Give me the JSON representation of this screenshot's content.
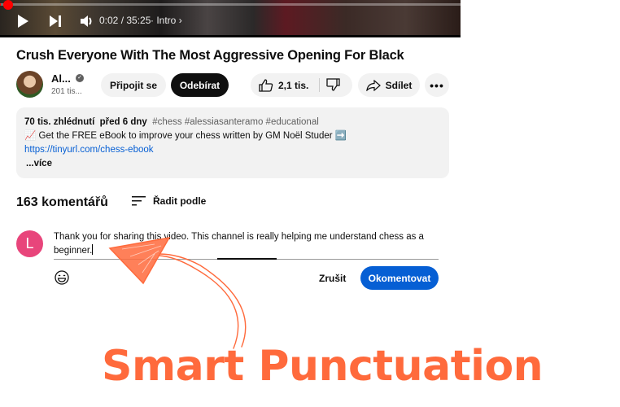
{
  "player": {
    "progress_percent": 0.1,
    "time_display": "0:02 / 35:25",
    "chapter": "Intro",
    "icons": [
      "play-icon",
      "next-icon",
      "volume-icon",
      "chevron-right-icon"
    ]
  },
  "video": {
    "title": "Crush Everyone With The Most Aggressive Opening For Black"
  },
  "channel": {
    "name": "Al...",
    "subscribers": "201 tis...",
    "verified": true
  },
  "actions": {
    "join_label": "Připojit se",
    "subscribe_label": "Odebírat",
    "likes": "2,1 tis.",
    "share_label": "Sdílet",
    "more_label": "..."
  },
  "description": {
    "views": "70 tis. zhlédnutí",
    "date": "před 6 dny",
    "tags": "#chess #alessiasanteramo #educational",
    "line1": "📈 Get the FREE eBook to improve your chess written by GM Noël Studer ➡️",
    "link": "https://tinyurl.com/chess-ebook",
    "more": "...více"
  },
  "comments": {
    "count": "163 komentářů",
    "sort_label": "Řadit podle",
    "user_initial": "L",
    "draft_text": "Thank you for sharing this video. This channel is really helping me understand chess as a beginner.",
    "cancel_label": "Zrušit",
    "submit_label": "Okomentovat"
  },
  "annotation": {
    "caption": "Smart Punctuation",
    "color": "#ff6a3c"
  },
  "colors": {
    "accent_blue": "#065fd4",
    "user_avatar": "#e8457b",
    "progress_red": "#ff0000"
  }
}
